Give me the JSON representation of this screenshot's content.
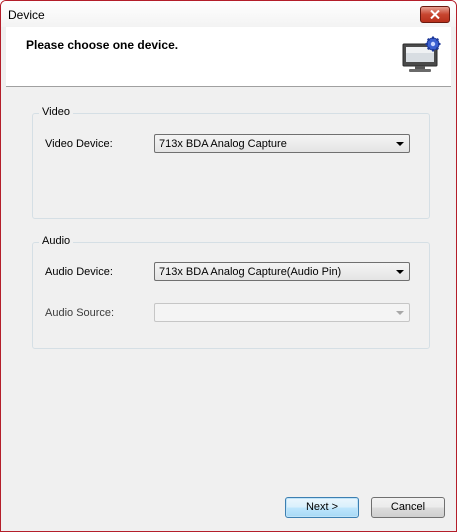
{
  "window": {
    "title": "Device"
  },
  "header": {
    "title": "Please choose one device."
  },
  "video_group": {
    "legend": "Video",
    "device_label": "Video Device:",
    "device_value": "713x BDA Analog Capture"
  },
  "audio_group": {
    "legend": "Audio",
    "device_label": "Audio Device:",
    "device_value": "713x BDA Analog Capture(Audio Pin)",
    "source_label": "Audio Source:",
    "source_value": ""
  },
  "buttons": {
    "next": "Next >",
    "cancel": "Cancel"
  },
  "colors": {
    "window_border": "#b41e2a",
    "close_button": "#c7452f",
    "dialog_background": "#f0f0f0"
  }
}
